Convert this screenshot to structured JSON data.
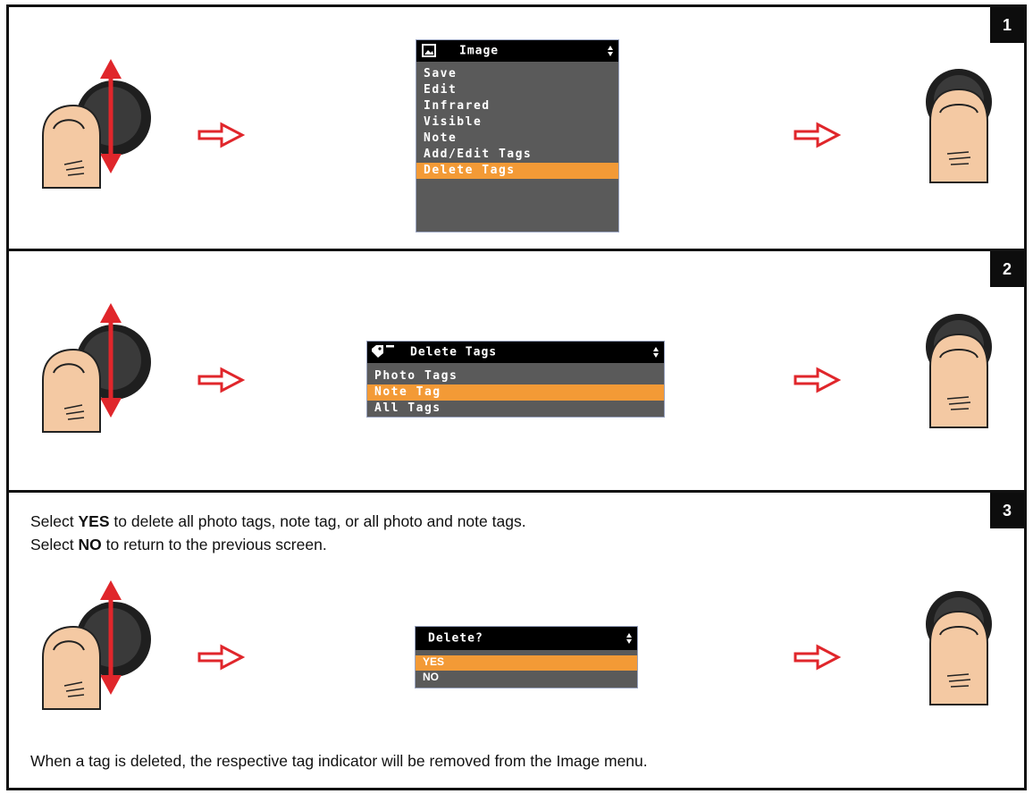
{
  "steps": [
    {
      "badge": "1",
      "screen": {
        "title": "Image",
        "title_icon": "image-icon",
        "items": [
          "Save",
          "Edit",
          "Infrared",
          "Visible",
          "Note",
          "Add/Edit Tags",
          "Delete Tags"
        ],
        "selected_index": 6
      }
    },
    {
      "badge": "2",
      "screen": {
        "title": "Delete Tags",
        "title_icon": "tag-icon",
        "items": [
          "Photo Tags",
          "Note Tag",
          "All Tags"
        ],
        "selected_index": 1
      }
    },
    {
      "badge": "3",
      "intro": {
        "line1_pre": "Select ",
        "line1_bold": "YES",
        "line1_post": " to delete all photo tags, note tag, or all photo and note tags.",
        "line2_pre": "Select ",
        "line2_bold": "NO",
        "line2_post": " to return to the previous screen."
      },
      "screen": {
        "title": "Delete?",
        "items": [
          "YES",
          "NO"
        ],
        "selected_index": 0
      },
      "note": "When a tag is deleted, the respective tag indicator will be removed from the Image menu."
    }
  ],
  "icons": {
    "scroll": "joystick-scroll-icon",
    "flow": "right-arrow-icon",
    "press": "joystick-press-icon"
  },
  "colors": {
    "highlight": "#f39a36",
    "arrow_red": "#e0262b",
    "lcd_bg": "#5a5a5a",
    "skin": "#f4c9a3"
  }
}
